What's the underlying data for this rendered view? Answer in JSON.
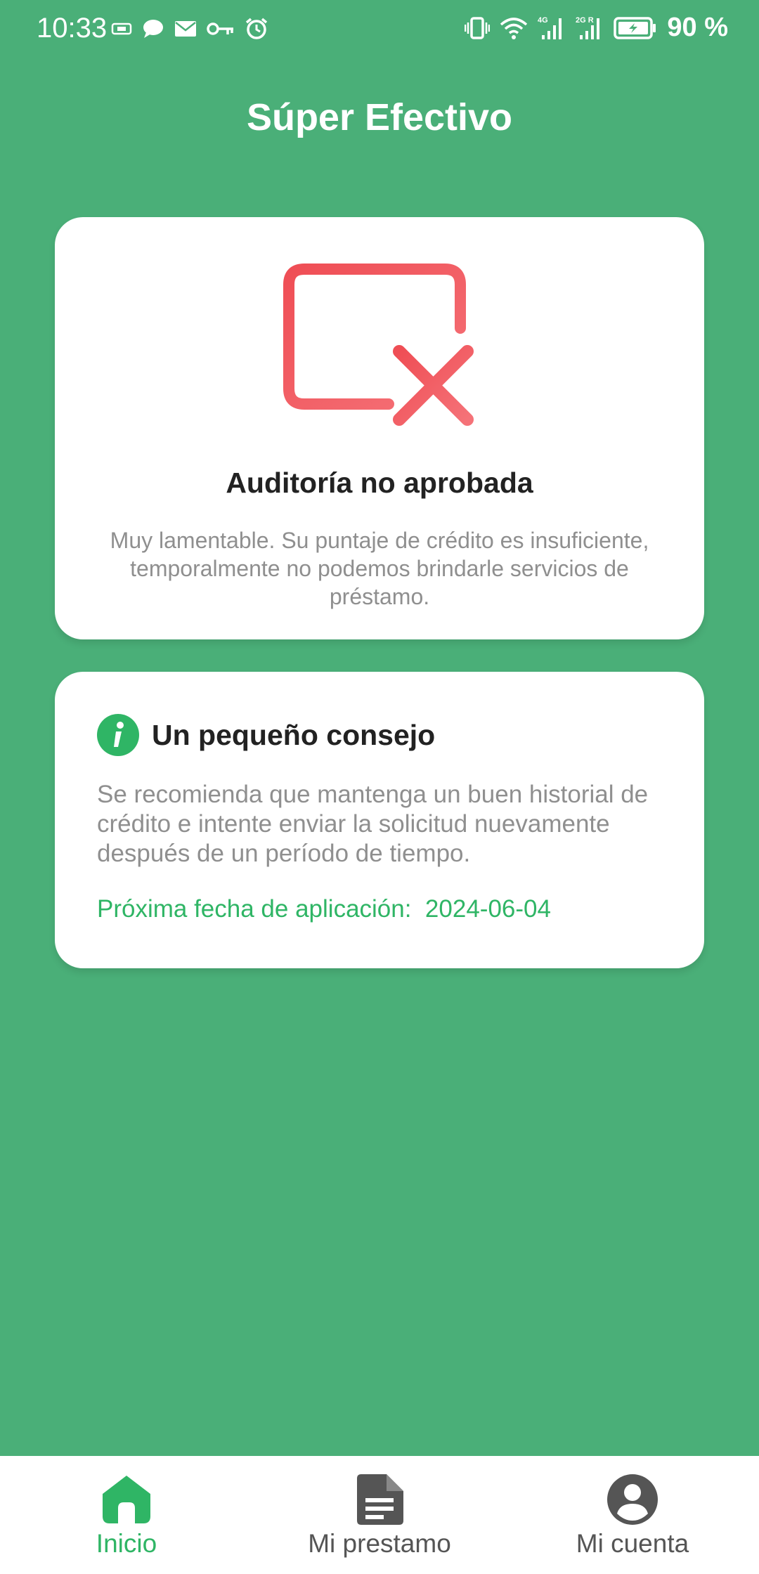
{
  "status_bar": {
    "time": "10:33",
    "battery": "90 %",
    "icons": [
      "sim-card-icon",
      "chat-icon",
      "mail-icon",
      "key-icon",
      "alarm-icon",
      "vibrate-icon",
      "wifi-icon",
      "signal-4g-icon",
      "signal-2g-icon",
      "battery-charging-icon"
    ],
    "network_labels": [
      "4G",
      "2G R"
    ]
  },
  "header": {
    "title": "Súper Efectivo"
  },
  "result_card": {
    "icon": "rejected-card-icon",
    "title": "Auditoría no aprobada",
    "description": "Muy lamentable. Su puntaje de crédito es insuficiente, temporalmente no podemos brindarle servicios de préstamo."
  },
  "tip_card": {
    "icon": "info-icon",
    "title": "Un pequeño consejo",
    "body": "Se recomienda que mantenga un buen historial de crédito e intente enviar la solicitud nuevamente después de un período de tiempo.",
    "next_date_label": "Próxima fecha de aplicación:  ",
    "next_date_value": "2024-06-04"
  },
  "bottom_nav": {
    "items": [
      {
        "label": "Inicio",
        "icon": "home-icon",
        "active": true
      },
      {
        "label": "Mi prestamo",
        "icon": "document-icon",
        "active": false
      },
      {
        "label": "Mi cuenta",
        "icon": "user-account-icon",
        "active": false
      }
    ]
  },
  "colors": {
    "background": "#4aaf78",
    "accent": "#2fb565",
    "error": "#f0565c",
    "nav_inactive": "#555555"
  }
}
